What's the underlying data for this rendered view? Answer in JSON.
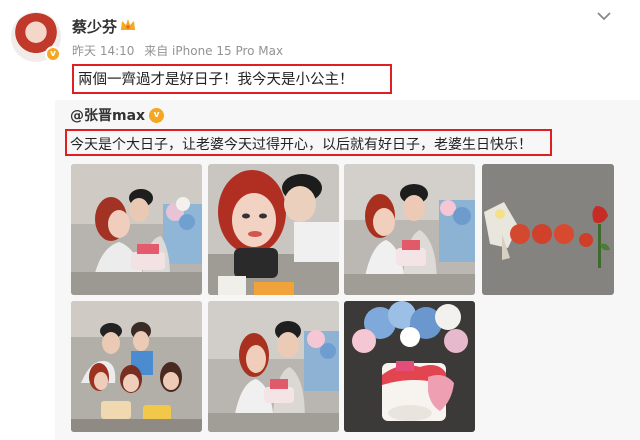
{
  "post": {
    "author": "蔡少芬",
    "meta": {
      "time": "昨天 14:10",
      "source": "来自 iPhone 15 Pro Max"
    },
    "text": "兩個一齊過才是好日子！我今天是小公主！"
  },
  "repost": {
    "author": "@张晋max",
    "text": "今天是个大日子，让老婆今天过得开心，以后就有好日子，老婆生日快乐！",
    "photos": [
      {
        "name": "photo-couple-kiss"
      },
      {
        "name": "photo-selfie-closeup"
      },
      {
        "name": "photo-couple-cake"
      },
      {
        "name": "photo-cookies-rose"
      },
      {
        "name": "photo-family-group"
      },
      {
        "name": "photo-couple-sofa"
      },
      {
        "name": "photo-birthday-cake"
      }
    ]
  },
  "colors": {
    "highlight_box": "#e02020",
    "vip_badge": "#f5a623",
    "repost_bg": "#f7f7f7"
  },
  "icons": {
    "chevron": "chevron-down-icon",
    "crown": "crown-icon",
    "verified": "verified-badge-icon"
  }
}
